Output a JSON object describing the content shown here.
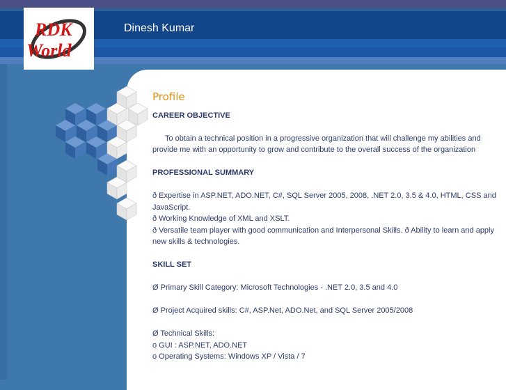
{
  "header": {
    "name": "Dinesh Kumar",
    "logo_text_top": "RDK",
    "logo_text_bottom": "World"
  },
  "content": {
    "title": "Profile",
    "career_objective": {
      "heading": "CAREER OBJECTIVE",
      "text": "To obtain a technical position in a progressive organization that will challenge my abilities and provide me with an opportunity to grow and contribute to the overall success of the organization"
    },
    "professional_summary": {
      "heading": "PROFESSIONAL SUMMARY",
      "line1": "ð  Expertise in ASP.NET, ADO.NET, C#, SQL Server 2005, 2008, .NET 2.0, 3.5 & 4.0, HTML, CSS and JavaScript.",
      "line2": "ð  Working Knowledge of XML and XSLT.",
      "line3": "ð  Versatile team player with good communication and Interpersonal Skills. ð  Ability to learn and apply new skills & technologies."
    },
    "skill_set": {
      "heading": "SKILL SET",
      "line1": "Ø  Primary Skill Category: Microsoft Technologies - .NET 2.0, 3.5 and 4.0",
      "line2": "Ø  Project Acquired skills: C#, ASP.Net, ADO.Net, and SQL Server 2005/2008",
      "line3": "Ø  Technical Skills:",
      "line4": "o    GUI : ASP.NET, ADO.NET",
      "line5": "o    Operating Systems: Windows XP / Vista / 7"
    }
  },
  "colors": {
    "header_dark": "#13458b",
    "background": "#3f78ad",
    "title_orange": "#e28e12",
    "text": "#2d3a6a"
  }
}
